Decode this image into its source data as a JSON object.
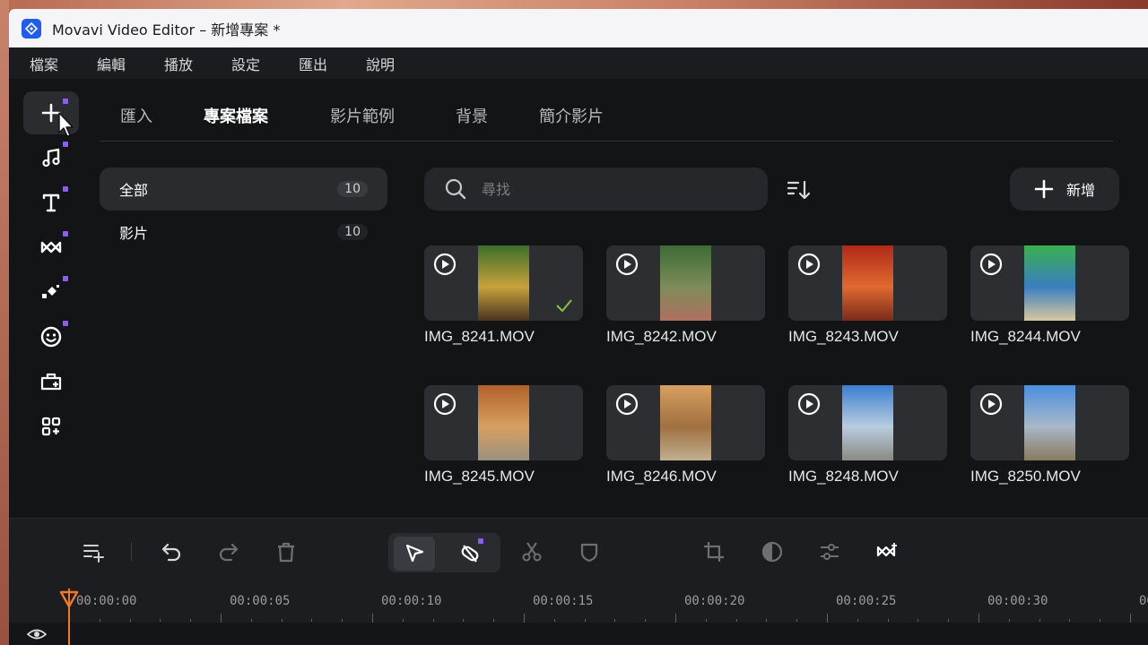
{
  "window": {
    "title": "Movavi Video Editor – 新增專案 *"
  },
  "menu": [
    "檔案",
    "編輯",
    "播放",
    "設定",
    "匯出",
    "說明"
  ],
  "rail": [
    {
      "icon": "add-media-icon",
      "active": true
    },
    {
      "icon": "music-note-icon"
    },
    {
      "icon": "text-icon"
    },
    {
      "icon": "transitions-icon"
    },
    {
      "icon": "effects-icon"
    },
    {
      "icon": "stickers-icon"
    },
    {
      "icon": "briefcase-plus-icon"
    },
    {
      "icon": "more-tools-icon"
    }
  ],
  "tabs": [
    "匯入",
    "專案檔案",
    "影片範例",
    "背景",
    "簡介影片"
  ],
  "active_tab": "專案檔案",
  "categories": [
    {
      "label": "全部",
      "count": "10",
      "active": true
    },
    {
      "label": "影片",
      "count": "10"
    }
  ],
  "search": {
    "placeholder": "尋找"
  },
  "add_button": {
    "label": "新增"
  },
  "media": [
    {
      "name": "IMG_8241.MOV",
      "selected": true,
      "colors": [
        "#3b6e2a",
        "#c7a23a",
        "#4a3420"
      ]
    },
    {
      "name": "IMG_8242.MOV",
      "colors": [
        "#3d6b35",
        "#7d8c5a",
        "#b07060"
      ]
    },
    {
      "name": "IMG_8243.MOV",
      "colors": [
        "#b02818",
        "#e06a30",
        "#7a2a1a"
      ]
    },
    {
      "name": "IMG_8244.MOV",
      "colors": [
        "#3ab050",
        "#3a7ec0",
        "#d8c8a0"
      ]
    },
    {
      "name": "IMG_8245.MOV",
      "colors": [
        "#b06028",
        "#d8a060",
        "#9a9080"
      ]
    },
    {
      "name": "IMG_8246.MOV",
      "colors": [
        "#d8a060",
        "#a07040",
        "#c0b090"
      ]
    },
    {
      "name": "IMG_8248.MOV",
      "colors": [
        "#3a7ed0",
        "#b8cce0",
        "#8a8a80"
      ]
    },
    {
      "name": "IMG_8250.MOV",
      "colors": [
        "#4a8ee0",
        "#a8b8c8",
        "#8a7a60"
      ]
    }
  ],
  "timeline": {
    "ticks": [
      "00:00:00",
      "00:00:05",
      "00:00:10",
      "00:00:15",
      "00:00:20",
      "00:00:25",
      "00:00:30",
      "00"
    ]
  },
  "colors": {
    "accent": "#8e5cf0",
    "playhead": "#f07a2a",
    "check": "#7ec83a"
  }
}
